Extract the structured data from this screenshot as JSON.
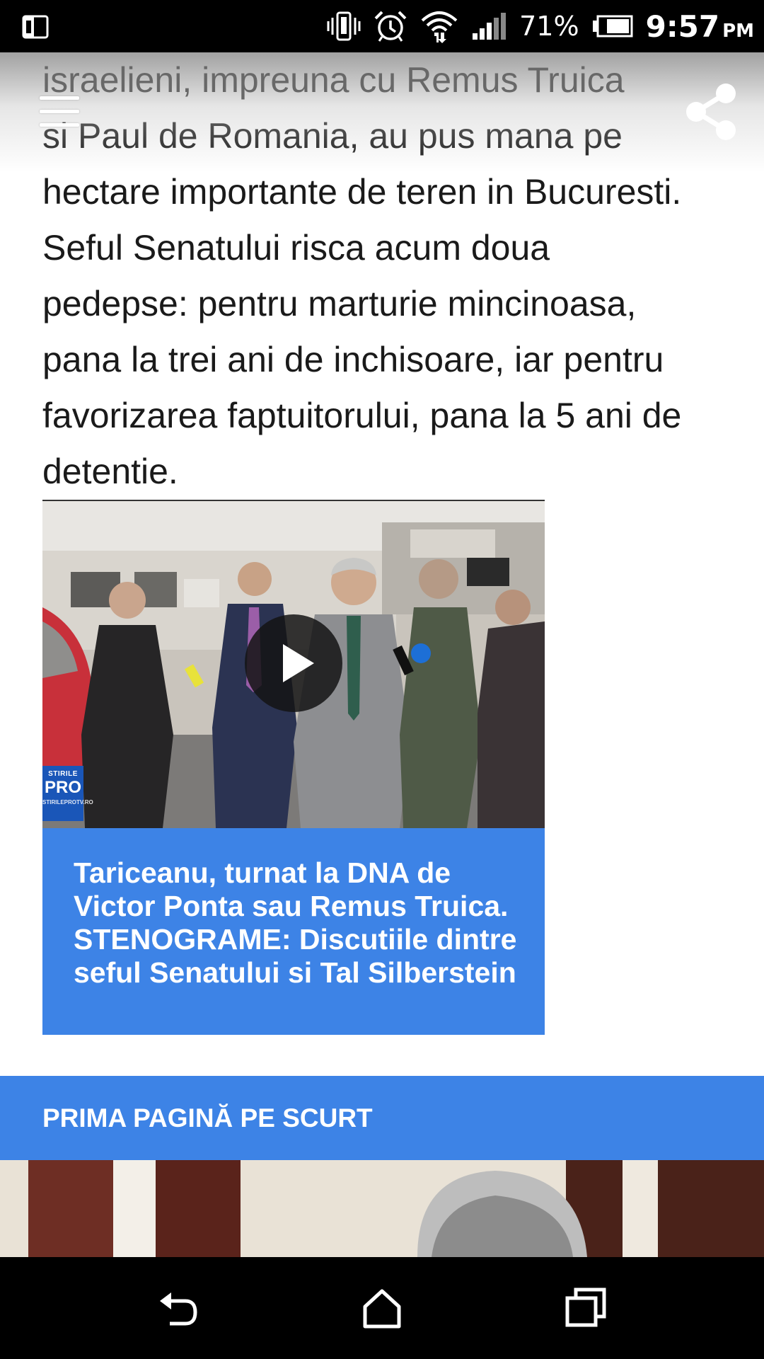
{
  "status_bar": {
    "left_icon": "screen-mirror-icon",
    "icons": [
      "vibrate-icon",
      "alarm-clock-icon",
      "wifi-icon",
      "signal-icon"
    ],
    "battery_percent": "71%",
    "battery_icon": "battery-icon",
    "time": "9:57",
    "ampm": "PM"
  },
  "toolbar": {
    "menu_icon": "hamburger-menu-icon",
    "share_icon": "share-icon"
  },
  "article": {
    "lines": [
      "israelieni, impreuna cu Remus Truica",
      "si Paul de Romania, au pus mana pe",
      "hectare importante de teren in Bucuresti.",
      "Seful Senatului risca acum doua",
      "pedepse: pentru marturie mincinoasa,",
      "pana la trei ani de inchisoare, iar pentru",
      "favorizarea faptuitorului, pana la 5 ani de",
      "detentie."
    ]
  },
  "video_card": {
    "play_icon": "play-icon",
    "channel_logo": {
      "line1": "STIRILE",
      "line2": "PRO",
      "line3": "STIRILEPROTV.RO"
    },
    "caption_lines": [
      "Tariceanu, turnat la DNA de",
      "Victor Ponta sau Remus Truica.",
      "STENOGRAME: Discutiile dintre",
      "seful Senatului si Tal Silberstein"
    ]
  },
  "section": {
    "title": "PRIMA PAGINĂ PE SCURT"
  },
  "nav_bar": {
    "back_icon": "back-icon",
    "home_icon": "home-icon",
    "recents_icon": "recent-apps-icon"
  },
  "colors": {
    "accent_blue": "#3d83e6",
    "status_bar": "#000000",
    "text": "#1a1a1a"
  }
}
